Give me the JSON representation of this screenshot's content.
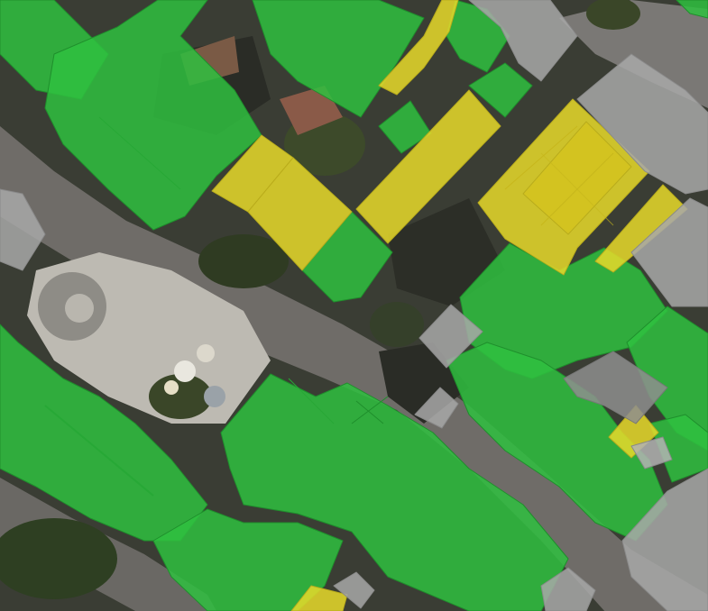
{
  "map": {
    "type": "aerial-orthophoto-with-building-overlay",
    "legend_visible": false,
    "labels_visible": false,
    "overlay_colors": {
      "green": "#2fbf3f",
      "yellow": "#e8d92a",
      "grey": "#a8a8a8"
    },
    "base_colors": {
      "road": "#6f6c68",
      "plaza": "#bdbab2",
      "vegetation": "#3d4a2a",
      "shadow": "#2a2c26",
      "roof_dark": "#4b4338"
    },
    "building_categories": [
      "green",
      "yellow",
      "grey"
    ]
  }
}
